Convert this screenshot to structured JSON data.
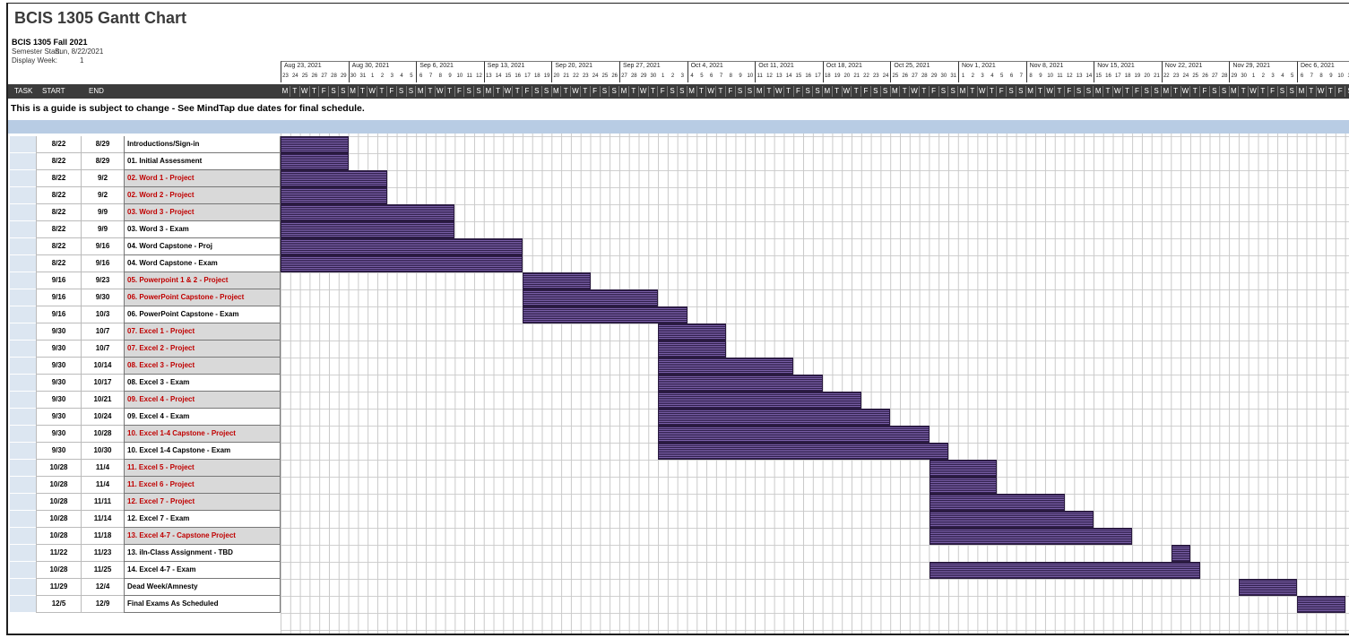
{
  "header": {
    "title": "BCIS 1305 Gantt Chart",
    "course": "BCIS 1305 Fall 2021",
    "semester_start_label": "Semester Start:",
    "semester_start_value": "Sun, 8/22/2021",
    "display_week_label": "Display Week:",
    "display_week_value": "1"
  },
  "columns": {
    "task": "TASK",
    "start": "START",
    "end": "END"
  },
  "weeks": [
    "Aug 23, 2021",
    "Aug 30, 2021",
    "Sep 6, 2021",
    "Sep 13, 2021",
    "Sep 20, 2021",
    "Sep 27, 2021",
    "Oct 4, 2021",
    "Oct 11, 2021",
    "Oct 18, 2021",
    "Oct 25, 2021",
    "Nov 1, 2021",
    "Nov 8, 2021",
    "Nov 15, 2021",
    "Nov 22, 2021",
    "Nov 29, 2021",
    "Dec 6, 2021"
  ],
  "day_letters": [
    "M",
    "T",
    "W",
    "T",
    "F",
    "S",
    "S"
  ],
  "note": "This is a guide is subject to change - See MindTap due dates for final schedule.",
  "colors": {
    "bar": "#5b3f8a",
    "header": "#3b3b3b",
    "band": "#b8cce4",
    "red_text": "#c00000"
  },
  "tasks": [
    {
      "start": "8/22",
      "end": "8/29",
      "name": "Introductions/Sign-in",
      "style": "white",
      "red": false,
      "s": 0,
      "e": 7
    },
    {
      "start": "8/22",
      "end": "8/29",
      "name": "01. Initial Assessment",
      "style": "white",
      "red": false,
      "s": 0,
      "e": 7
    },
    {
      "start": "8/22",
      "end": "9/2",
      "name": "02. Word 1 - Project",
      "style": "grey",
      "red": true,
      "s": 0,
      "e": 11
    },
    {
      "start": "8/22",
      "end": "9/2",
      "name": "02. Word 2 - Project",
      "style": "grey",
      "red": true,
      "s": 0,
      "e": 11
    },
    {
      "start": "8/22",
      "end": "9/9",
      "name": "03. Word 3 - Project",
      "style": "grey",
      "red": true,
      "s": 0,
      "e": 18
    },
    {
      "start": "8/22",
      "end": "9/9",
      "name": "03. Word 3 - Exam",
      "style": "white",
      "red": false,
      "s": 0,
      "e": 18
    },
    {
      "start": "8/22",
      "end": "9/16",
      "name": "04. Word Capstone - Proj",
      "style": "white",
      "red": false,
      "s": 0,
      "e": 25
    },
    {
      "start": "8/22",
      "end": "9/16",
      "name": "04. Word Capstone - Exam",
      "style": "white",
      "red": false,
      "s": 0,
      "e": 25
    },
    {
      "start": "9/16",
      "end": "9/23",
      "name": "05. Powerpoint 1 & 2 - Project",
      "style": "grey",
      "red": true,
      "s": 25,
      "e": 32
    },
    {
      "start": "9/16",
      "end": "9/30",
      "name": "06. PowerPoint Capstone - Project",
      "style": "grey",
      "red": true,
      "s": 25,
      "e": 39
    },
    {
      "start": "9/16",
      "end": "10/3",
      "name": "06. PowerPoint Capstone - Exam",
      "style": "white",
      "red": false,
      "s": 25,
      "e": 42
    },
    {
      "start": "9/30",
      "end": "10/7",
      "name": "07. Excel 1 - Project",
      "style": "grey",
      "red": true,
      "s": 39,
      "e": 46
    },
    {
      "start": "9/30",
      "end": "10/7",
      "name": "07. Excel 2 - Project",
      "style": "grey",
      "red": true,
      "s": 39,
      "e": 46
    },
    {
      "start": "9/30",
      "end": "10/14",
      "name": "08. Excel 3 - Project",
      "style": "grey",
      "red": true,
      "s": 39,
      "e": 53
    },
    {
      "start": "9/30",
      "end": "10/17",
      "name": "08. Excel 3 - Exam",
      "style": "white",
      "red": false,
      "s": 39,
      "e": 56
    },
    {
      "start": "9/30",
      "end": "10/21",
      "name": "09. Excel 4 - Project",
      "style": "grey",
      "red": true,
      "s": 39,
      "e": 60
    },
    {
      "start": "9/30",
      "end": "10/24",
      "name": "09. Excel 4 - Exam",
      "style": "white",
      "red": false,
      "s": 39,
      "e": 63
    },
    {
      "start": "9/30",
      "end": "10/28",
      "name": "10. Excel 1-4 Capstone - Project",
      "style": "grey",
      "red": true,
      "s": 39,
      "e": 67
    },
    {
      "start": "9/30",
      "end": "10/30",
      "name": "10. Excel 1-4 Capstone - Exam",
      "style": "white",
      "red": false,
      "s": 39,
      "e": 69
    },
    {
      "start": "10/28",
      "end": "11/4",
      "name": "11. Excel 5 - Project",
      "style": "grey",
      "red": true,
      "s": 67,
      "e": 74
    },
    {
      "start": "10/28",
      "end": "11/4",
      "name": "11. Excel 6 - Project",
      "style": "grey",
      "red": true,
      "s": 67,
      "e": 74
    },
    {
      "start": "10/28",
      "end": "11/11",
      "name": "12. Excel 7 - Project",
      "style": "grey",
      "red": true,
      "s": 67,
      "e": 81
    },
    {
      "start": "10/28",
      "end": "11/14",
      "name": "12. Excel 7 - Exam",
      "style": "white",
      "red": false,
      "s": 67,
      "e": 84
    },
    {
      "start": "10/28",
      "end": "11/18",
      "name": "13. Excel 4-7 - Capstone Project",
      "style": "grey",
      "red": true,
      "s": 67,
      "e": 88
    },
    {
      "start": "11/22",
      "end": "11/23",
      "name": "13. iIn-Class Assignment - TBD",
      "style": "white",
      "red": false,
      "s": 92,
      "e": 94
    },
    {
      "start": "10/28",
      "end": "11/25",
      "name": "14. Excel 4-7 - Exam",
      "style": "white",
      "red": false,
      "s": 67,
      "e": 95
    },
    {
      "start": "11/29",
      "end": "12/4",
      "name": "Dead Week/Amnesty",
      "style": "white",
      "red": false,
      "s": 99,
      "e": 105
    },
    {
      "start": "12/5",
      "end": "12/9",
      "name": "Final Exams As Scheduled",
      "style": "white",
      "red": false,
      "s": 105,
      "e": 110
    }
  ]
}
